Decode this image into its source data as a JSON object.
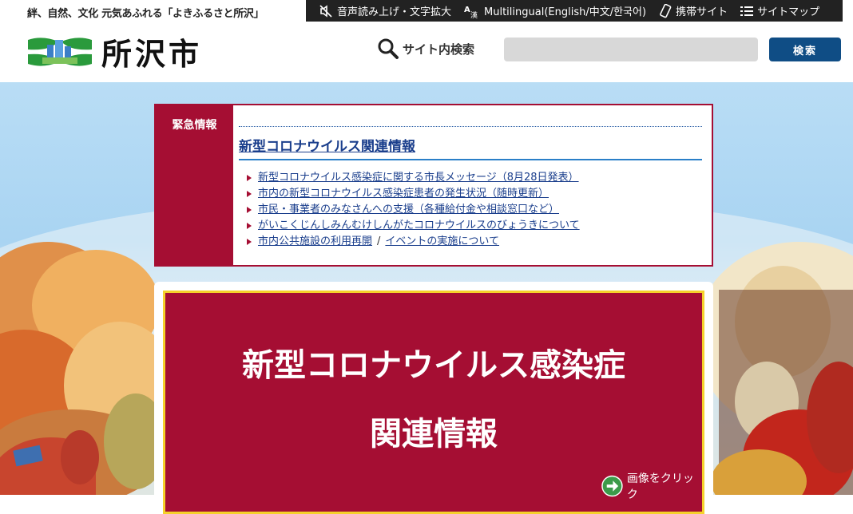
{
  "header": {
    "tagline": "絆、自然、文化 元気あふれる「よきふるさと所沢」",
    "utility": {
      "read_aloud": "音声読み上げ・文字拡大",
      "multilingual": "Multilingual(English/中文/한국어)",
      "mobile": "携帯サイト",
      "sitemap": "サイトマップ"
    },
    "logo_text": "所沢市",
    "search": {
      "label": "サイト内検索",
      "placeholder": "",
      "button": "検索"
    }
  },
  "emergency": {
    "label": "緊急情報",
    "heading": "新型コロナウイルス関連情報",
    "links": [
      "新型コロナウイルス感染症に関する市長メッセージ（8月28日発表）",
      "市内の新型コロナウイルス感染症患者の発生状況（随時更新）",
      "市民・事業者のみなさんへの支援（各種給付金や相談窓口など）",
      "がいこくじんしみんむけしんがたコロナウイルスのびょうきについて"
    ],
    "last_link_a": "市内公共施設の利用再開",
    "last_sep": "/",
    "last_link_b": "イベントの実施について"
  },
  "banner": {
    "line1": "新型コロナウイルス感染症",
    "line2": "関連情報",
    "click_hint": "画像をクリック"
  },
  "colors": {
    "accent_red": "#a50e33",
    "navy": "#0f4d85",
    "logo_green": "#2a9a3c",
    "banner_border": "#f5d12b"
  }
}
